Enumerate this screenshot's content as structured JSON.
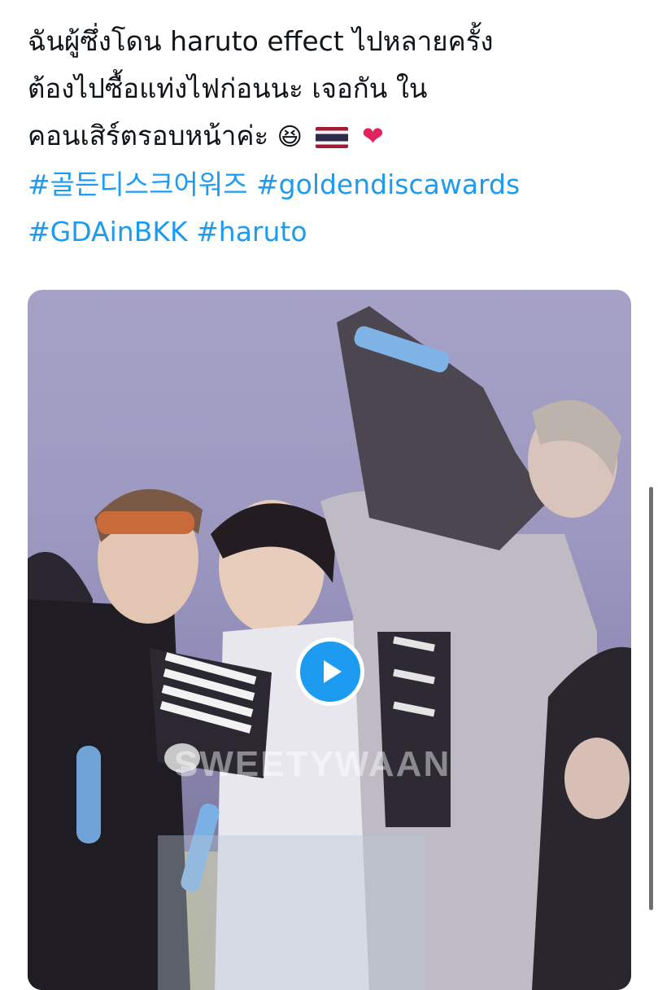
{
  "tweet": {
    "line1": "ฉันผู้ซึ่งโดน haruto effect ไปหลายครั้ง",
    "line2": "ต้องไปซื้อแท่งไฟก่อนนะ เจอกัน ใน",
    "line3": "คอนเสิร์ตรอบหน้าค่ะ",
    "emoji_grin": "😆",
    "emoji_heart": "❤",
    "hashtags": [
      "#골든디스크어워즈",
      "#goldendiscawards",
      "#GDAinBKK",
      "#haruto"
    ]
  },
  "media": {
    "watermark": "SWEETYWAAN",
    "play_icon": "play-icon"
  },
  "colors": {
    "hashtag": "#1d9bf0",
    "play_button": "#1d9bf0",
    "text": "#0f1419"
  }
}
